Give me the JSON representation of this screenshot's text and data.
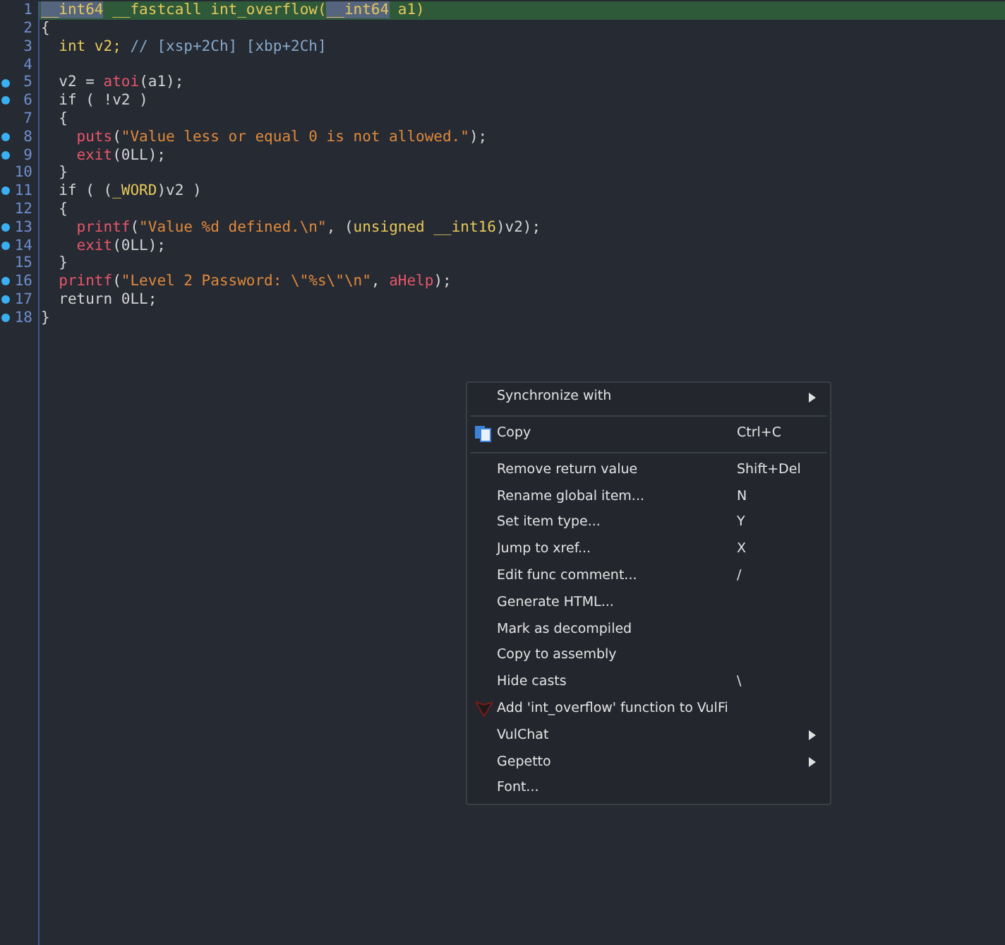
{
  "code_lines": [
    {
      "number": "1",
      "breakpoint": false,
      "current": true,
      "tokens": [
        {
          "kind": "highlight",
          "text": "__int64"
        },
        {
          "kind": "type",
          "text": " __fastcall int_overflow("
        },
        {
          "kind": "highlight",
          "text": "__int64"
        },
        {
          "kind": "type",
          "text": " a1)"
        }
      ]
    },
    {
      "number": "2",
      "breakpoint": false,
      "current": false,
      "tokens": [
        {
          "kind": "plain",
          "text": "{"
        }
      ]
    },
    {
      "number": "3",
      "breakpoint": false,
      "current": false,
      "tokens": [
        {
          "kind": "type",
          "text": "  int v2;"
        },
        {
          "kind": "comment",
          "text": " // [xsp+2Ch] [xbp+2Ch]"
        }
      ]
    },
    {
      "number": "4",
      "breakpoint": false,
      "current": false
    },
    {
      "number": "5",
      "breakpoint": true,
      "current": false,
      "tokens": [
        {
          "kind": "plain",
          "text": "  v2 = "
        },
        {
          "kind": "func",
          "text": "atoi"
        },
        {
          "kind": "plain",
          "text": "(a1);"
        }
      ]
    },
    {
      "number": "6",
      "breakpoint": true,
      "current": false,
      "tokens": [
        {
          "kind": "plain",
          "text": "  if ( !v2 )"
        }
      ]
    },
    {
      "number": "7",
      "breakpoint": false,
      "current": false,
      "tokens": [
        {
          "kind": "plain",
          "text": "  {"
        }
      ]
    },
    {
      "number": "8",
      "breakpoint": true,
      "current": false,
      "tokens": [
        {
          "kind": "func",
          "text": "    puts"
        },
        {
          "kind": "plain",
          "text": "("
        },
        {
          "kind": "string",
          "text": "\"Value less or equal 0 is not allowed.\""
        },
        {
          "kind": "plain",
          "text": ");"
        }
      ]
    },
    {
      "number": "9",
      "breakpoint": true,
      "current": false,
      "tokens": [
        {
          "kind": "func",
          "text": "    exit"
        },
        {
          "kind": "plain",
          "text": "(0LL);"
        }
      ]
    },
    {
      "number": "10",
      "breakpoint": false,
      "current": false,
      "tokens": [
        {
          "kind": "plain",
          "text": "  }"
        }
      ]
    },
    {
      "number": "11",
      "breakpoint": true,
      "current": false,
      "tokens": [
        {
          "kind": "plain",
          "text": "  if ( ("
        },
        {
          "kind": "type",
          "text": "_WORD"
        },
        {
          "kind": "plain",
          "text": ")v2 )"
        }
      ]
    },
    {
      "number": "12",
      "breakpoint": false,
      "current": false,
      "tokens": [
        {
          "kind": "plain",
          "text": "  {"
        }
      ]
    },
    {
      "number": "13",
      "breakpoint": true,
      "current": false,
      "tokens": [
        {
          "kind": "func",
          "text": "    printf"
        },
        {
          "kind": "plain",
          "text": "("
        },
        {
          "kind": "string",
          "text": "\"Value %d defined.\\n\""
        },
        {
          "kind": "plain",
          "text": ", ("
        },
        {
          "kind": "type",
          "text": "unsigned __int16"
        },
        {
          "kind": "plain",
          "text": ")v2);"
        }
      ]
    },
    {
      "number": "14",
      "breakpoint": true,
      "current": false,
      "tokens": [
        {
          "kind": "func",
          "text": "    exit"
        },
        {
          "kind": "plain",
          "text": "(0LL);"
        }
      ]
    },
    {
      "number": "15",
      "breakpoint": false,
      "current": false,
      "tokens": [
        {
          "kind": "plain",
          "text": "  }"
        }
      ]
    },
    {
      "number": "16",
      "breakpoint": true,
      "current": false,
      "tokens": [
        {
          "kind": "func",
          "text": "  printf"
        },
        {
          "kind": "plain",
          "text": "("
        },
        {
          "kind": "string",
          "text": "\"Level 2 Password: \\\"%s\\\"\\n\""
        },
        {
          "kind": "plain",
          "text": ", "
        },
        {
          "kind": "func",
          "text": "aHelp"
        },
        {
          "kind": "plain",
          "text": ");"
        }
      ]
    },
    {
      "number": "17",
      "breakpoint": true,
      "current": false,
      "tokens": [
        {
          "kind": "plain",
          "text": "  return 0LL;"
        }
      ]
    },
    {
      "number": "18",
      "breakpoint": true,
      "current": false,
      "tokens": [
        {
          "kind": "plain",
          "text": "}"
        }
      ]
    }
  ],
  "context_menu": [
    {
      "kind": "plain",
      "label": "Synchronize with",
      "submenu": true
    },
    {
      "kind": "separator"
    },
    {
      "kind": "copy",
      "label": "Copy",
      "shortcut": "Ctrl+C",
      "submenu": false
    },
    {
      "kind": "separator"
    },
    {
      "kind": "plain",
      "label": "Remove return value",
      "shortcut": "Shift+Del",
      "submenu": false
    },
    {
      "kind": "plain",
      "label": "Rename global item...",
      "shortcut": "N",
      "submenu": false
    },
    {
      "kind": "plain",
      "label": "Set item type...",
      "shortcut": "Y",
      "submenu": false
    },
    {
      "kind": "plain",
      "label": "Jump to xref...",
      "shortcut": "X",
      "submenu": false
    },
    {
      "kind": "plain",
      "label": "Edit func comment...",
      "shortcut": "/",
      "submenu": false
    },
    {
      "kind": "plain",
      "label": "Generate HTML...",
      "submenu": false
    },
    {
      "kind": "plain",
      "label": "Mark as decompiled",
      "submenu": false
    },
    {
      "kind": "plain",
      "label": "Copy to assembly",
      "submenu": false
    },
    {
      "kind": "plain",
      "label": "Hide casts",
      "shortcut": "\\",
      "submenu": false
    },
    {
      "kind": "plugin",
      "label": "Add 'int_overflow' function to VulFi",
      "submenu": false
    },
    {
      "kind": "plain",
      "label": "VulChat",
      "submenu": true
    },
    {
      "kind": "plain",
      "label": "Gepetto",
      "submenu": true
    },
    {
      "kind": "plain",
      "label": "Font...",
      "submenu": false
    }
  ]
}
